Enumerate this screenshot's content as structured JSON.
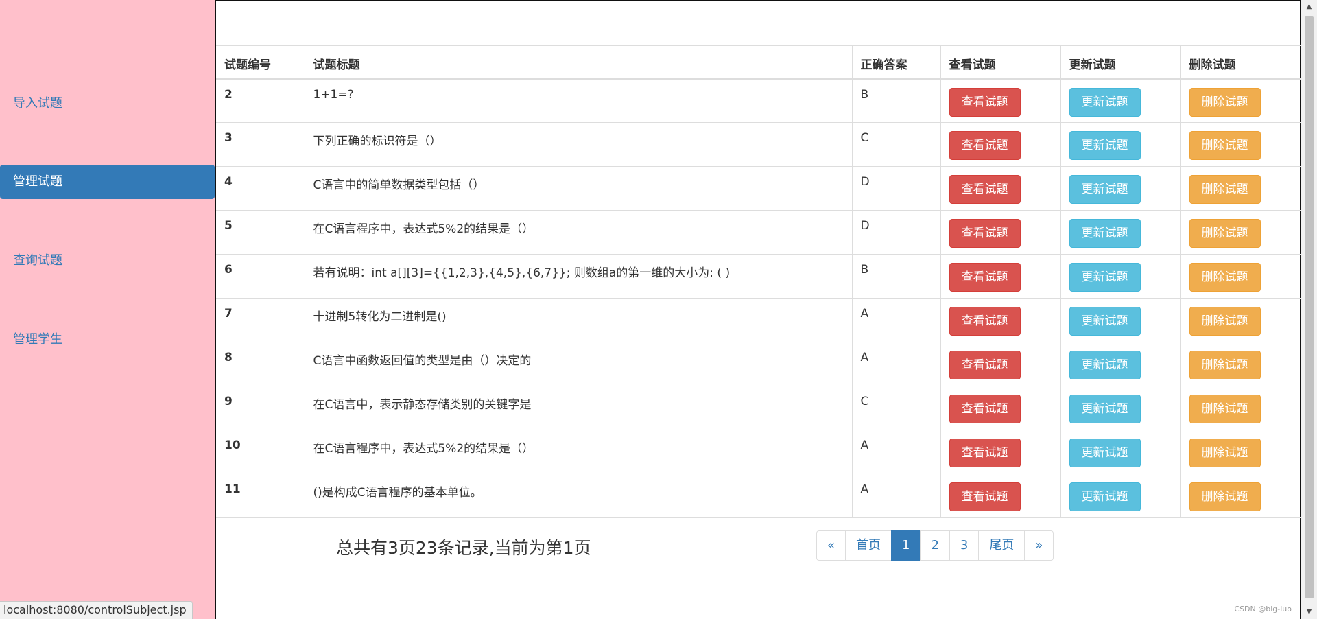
{
  "sidebar": {
    "items": [
      {
        "label": "导入试题",
        "active": false
      },
      {
        "label": "管理试题",
        "active": true
      },
      {
        "label": "查询试题",
        "active": false
      },
      {
        "label": "管理学生",
        "active": false
      }
    ]
  },
  "table": {
    "headers": [
      "试题编号",
      "试题标题",
      "正确答案",
      "查看试题",
      "更新试题",
      "删除试题"
    ],
    "button_labels": {
      "view": "查看试题",
      "update": "更新试题",
      "delete": "删除试题"
    },
    "rows": [
      {
        "id": "2",
        "title": "1+1=?",
        "answer": "B"
      },
      {
        "id": "3",
        "title": "下列正确的标识符是（）",
        "answer": "C"
      },
      {
        "id": "4",
        "title": "C语言中的简单数据类型包括（）",
        "answer": "D"
      },
      {
        "id": "5",
        "title": "在C语言程序中，表达式5%2的结果是（）",
        "answer": "D"
      },
      {
        "id": "6",
        "title": "若有说明：int a[][3]={{1,2,3},{4,5},{6,7}}; 则数组a的第一维的大小为: ( )",
        "answer": "B"
      },
      {
        "id": "7",
        "title": "十进制5转化为二进制是()",
        "answer": "A"
      },
      {
        "id": "8",
        "title": "C语言中函数返回值的类型是由（）决定的",
        "answer": "A"
      },
      {
        "id": "9",
        "title": "在C语言中，表示静态存储类别的关键字是",
        "answer": "C"
      },
      {
        "id": "10",
        "title": "在C语言程序中，表达式5%2的结果是（）",
        "answer": "A"
      },
      {
        "id": "11",
        "title": "()是构成C语言程序的基本单位。",
        "answer": "A"
      }
    ]
  },
  "record_info": "总共有3页23条记录,当前为第1页",
  "pagination": [
    {
      "label": "«",
      "active": false
    },
    {
      "label": "首页",
      "active": false
    },
    {
      "label": "1",
      "active": true
    },
    {
      "label": "2",
      "active": false
    },
    {
      "label": "3",
      "active": false
    },
    {
      "label": "尾页",
      "active": false
    },
    {
      "label": "»",
      "active": false
    }
  ],
  "status_bar": "localhost:8080/controlSubject.jsp",
  "watermark": "CSDN @big-luo",
  "colors": {
    "sidebar_bg": "#ffc0cb",
    "primary": "#337ab7",
    "danger": "#d9534f",
    "info": "#5bc0de",
    "warning": "#f0ad4e"
  }
}
